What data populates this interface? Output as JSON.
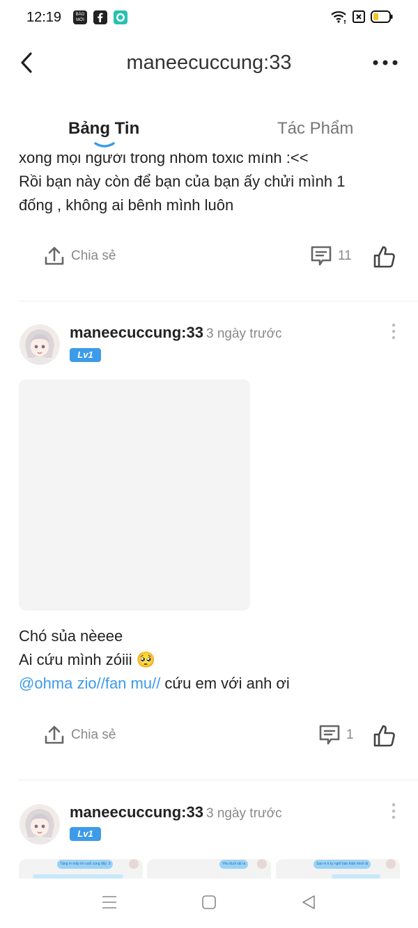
{
  "status_bar": {
    "time": "12:19",
    "app_badge_text": "BÁO MỚI",
    "app_icons": [
      "baomoi-app-icon",
      "facebook-app-icon",
      "messenger-app-icon"
    ],
    "system_icons": [
      "wifi-icon",
      "sim-blocked-icon",
      "battery-icon"
    ]
  },
  "header": {
    "title": "maneecuccung:33",
    "back_icon": "chevron-left-icon",
    "more_icon": "more-horizontal-icon"
  },
  "tabs": [
    {
      "label": "Bảng Tin",
      "active": true
    },
    {
      "label": "Tác Phẩm",
      "active": false
    }
  ],
  "posts": [
    {
      "text_lines": [
        "xong mọi người trong nhóm toxic mình :<<",
        "Rồi bạn này còn để bạn của bạn ấy chửi mình 1",
        "đống , không ai bênh mình luôn"
      ],
      "share_label": "Chia sẻ",
      "comment_count": "11"
    },
    {
      "author": "maneecuccung:33",
      "time": "3 ngày trước",
      "level": "Lv1",
      "text_lines": [
        "Chó sủa nèeee",
        "Ai cứu mình zóiii 🥺"
      ],
      "mention": "@ohma zio//fan mu//",
      "mention_suffix": " cứu em với anh ơi",
      "share_label": "Chia sẻ",
      "comment_count": "1"
    },
    {
      "author": "maneecuccung:33",
      "time": "3 ngày trước",
      "level": "Lv1",
      "image_texts": [
        "Tặng m mấy lời cuối cùng đấy :3",
        "Yêu đuối vãi ra",
        "Sao m k tự nghĩ bản thân mình đi"
      ]
    }
  ],
  "navbar": {
    "icons": [
      "menu-icon",
      "home-square-icon",
      "back-triangle-icon"
    ]
  },
  "colors": {
    "accent": "#3d9be9",
    "text": "#222222",
    "muted": "#888888"
  }
}
